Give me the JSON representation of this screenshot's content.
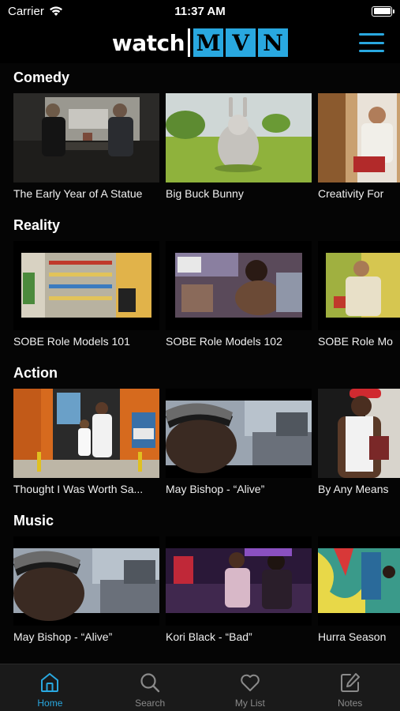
{
  "status_bar": {
    "carrier": "Carrier",
    "time": "11:37 AM"
  },
  "nav": {
    "logo_prefix": "watch",
    "logo_letters": [
      "M",
      "V",
      "N"
    ],
    "menu_icon": "hamburger-icon"
  },
  "sections": [
    {
      "title": "Comedy",
      "items": [
        {
          "title": "The Early Year of A Statue"
        },
        {
          "title": "Big Buck Bunny"
        },
        {
          "title": "Creativity For"
        }
      ]
    },
    {
      "title": "Reality",
      "items": [
        {
          "title": "SOBE Role Models 101"
        },
        {
          "title": "SOBE Role Models 102"
        },
        {
          "title": "SOBE Role Mo"
        }
      ]
    },
    {
      "title": "Action",
      "items": [
        {
          "title": "Thought I Was Worth Sa..."
        },
        {
          "title": "May Bishop - “Alive”"
        },
        {
          "title": "By Any Means"
        }
      ]
    },
    {
      "title": "Music",
      "items": [
        {
          "title": "May Bishop - “Alive”"
        },
        {
          "title": "Kori Black - “Bad”"
        },
        {
          "title": "Hurra Season"
        }
      ]
    }
  ],
  "tabs": [
    {
      "label": "Home",
      "icon": "home-icon",
      "active": true
    },
    {
      "label": "Search",
      "icon": "search-icon",
      "active": false
    },
    {
      "label": "My List",
      "icon": "heart-icon",
      "active": false
    },
    {
      "label": "Notes",
      "icon": "notes-icon",
      "active": false
    }
  ],
  "colors": {
    "accent": "#29a8e0",
    "background": "#000000",
    "tab_bar": "#1a1a1a"
  }
}
